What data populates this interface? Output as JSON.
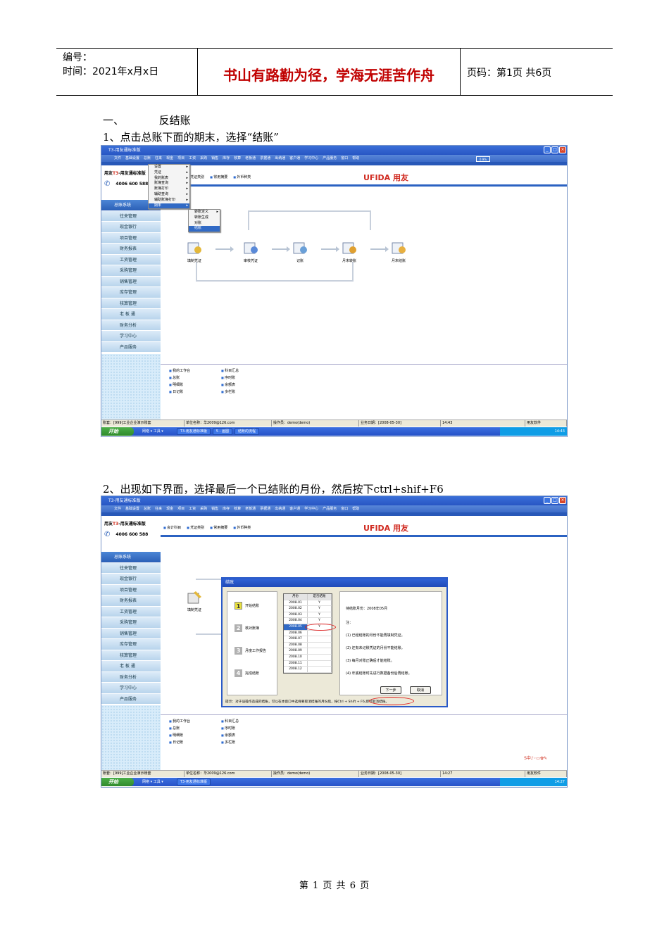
{
  "header": {
    "number_label": "编号：",
    "date_label": "时间：2021年x月x日",
    "motto": "书山有路勤为径，学海无涯苦作舟",
    "page_label": "页码：第1页  共6页"
  },
  "section": {
    "heading_num": "一、",
    "heading_text": "反结账",
    "step1": "1、点击总账下面的期末，选择“结账”",
    "step2": "2、出现如下界面，选择最后一个已结账的月份，然后按下ctrl+shif+F6"
  },
  "app": {
    "title": "T3-用友通标准版",
    "menu": [
      "文件",
      "基础设置",
      "总账",
      "往来",
      "现金",
      "项目",
      "工资",
      "采购",
      "销售",
      "库存",
      "核算",
      "老板通",
      "票据通",
      "出纳通",
      "客户通",
      "学习中心",
      "产品服务",
      "窗口",
      "帮助"
    ],
    "brand_prefix": "用友",
    "brand_t3": "T3",
    "brand_suffix": "-用友通标准版",
    "phone": "4006 600 588",
    "toolbar": [
      "会计科目",
      "凭证类别",
      "常用摘要",
      "外币种类"
    ],
    "ufida": "UFIDA",
    "ufida_cn": "用友",
    "sidebar": [
      "总账系统",
      "往来管理",
      "现金银行",
      "项目管理",
      "财务报表",
      "工资管理",
      "采购管理",
      "销售管理",
      "库存管理",
      "核算管理",
      "老 板 通",
      "财务分析",
      "学习中心",
      "产品服务"
    ],
    "flow": [
      "填制凭证",
      "审核凭证",
      "记账",
      "月末转账",
      "月末结账"
    ],
    "links_left": [
      "我的工作台",
      "总账",
      "明细账",
      "日记账"
    ],
    "links_right": [
      "科目汇总",
      "序时账",
      "余额表",
      "多栏账"
    ],
    "progress": "0.9%"
  },
  "menu1": {
    "items": [
      "设置",
      "凭证",
      "我的账表",
      "账簿查询",
      "账簿打印",
      "辅助查询",
      "辅助账簿打印",
      "期末"
    ],
    "sub": [
      "转账定义",
      "转账生成",
      "对账",
      "结账"
    ]
  },
  "status1": {
    "account": "账套：[999]工业企业演示账套",
    "unit": "单位名称：华2009@126.com",
    "operator": "操作员：demo(demo)",
    "date": "业务日期：[2008-05-30]",
    "time": "14:43",
    "vendor": "用友软件"
  },
  "taskbar1": {
    "start": "开始",
    "quick": "网络 ▾  工具 ▾",
    "tasks": [
      "T3-用友通标准版",
      "5 - 画图",
      "结账的流程"
    ],
    "clock": "14:43"
  },
  "dialog": {
    "title": "结账",
    "steps": [
      "开始结账",
      "核对账簿",
      "月度工作报告",
      "完成结账"
    ],
    "col_month": "月份",
    "col_done": "是否结账",
    "months": [
      [
        "2008.01",
        "Y"
      ],
      [
        "2008.02",
        "Y"
      ],
      [
        "2008.03",
        "Y"
      ],
      [
        "2008.04",
        "Y"
      ],
      [
        "2008.05",
        "Y"
      ],
      [
        "2008.06",
        ""
      ],
      [
        "2008.07",
        ""
      ],
      [
        "2008.08",
        ""
      ],
      [
        "2008.09",
        ""
      ],
      [
        "2008.10",
        ""
      ],
      [
        "2008.11",
        ""
      ],
      [
        "2008.12",
        ""
      ]
    ],
    "pending": "待结账月份：2008年05月",
    "note_title": "注：",
    "notes": [
      "(1) 已经结账的月份不能再填制凭证。",
      "(2) 还有未记账凭证的月份不能结账。",
      "(3) 每月对账正确后才能结账。",
      "(4) 年底结账时先进行数据备份后再结账。"
    ],
    "next": "下一步",
    "cancel": "取消",
    "tip": "提示：对于误操作造成的结账，可以在本窗口中选择要取消结账的月份后，按Ctrl + Shift + F6,即可取消结账。"
  },
  "status2": {
    "account": "账套：[999]工业企业演示账套",
    "unit": "单位名称：华2009@126.com",
    "operator": "操作员：demo(demo)",
    "date": "业务日期：[2008-05-30]",
    "time": "14:27",
    "vendor": "用友软件"
  },
  "taskbar2": {
    "start": "开始",
    "quick": "网络 ▾  工具 ▾",
    "tasks": [
      "T3-用友通标准版"
    ],
    "clock": "14:27"
  },
  "footer": "第 1 页 共 6 页"
}
